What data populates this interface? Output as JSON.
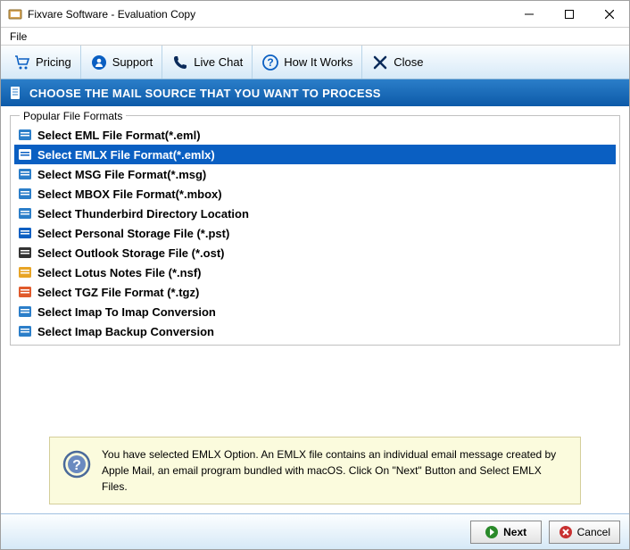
{
  "titlebar": {
    "title": "Fixvare Software - Evaluation Copy"
  },
  "menubar": {
    "file": "File"
  },
  "toolbar": {
    "pricing": "Pricing",
    "support": "Support",
    "livechat": "Live Chat",
    "howitworks": "How It Works",
    "close": "Close"
  },
  "header": {
    "text": "CHOOSE THE MAIL SOURCE THAT YOU WANT TO PROCESS"
  },
  "list": {
    "legend": "Popular File Formats",
    "items": [
      {
        "label": "Select EML File Format(*.eml)",
        "selected": false,
        "iconColor": "#2b7ec9"
      },
      {
        "label": "Select EMLX File Format(*.emlx)",
        "selected": true,
        "iconColor": "#ffffff"
      },
      {
        "label": "Select MSG File Format(*.msg)",
        "selected": false,
        "iconColor": "#2b7ec9"
      },
      {
        "label": "Select MBOX File Format(*.mbox)",
        "selected": false,
        "iconColor": "#2b7ec9"
      },
      {
        "label": "Select Thunderbird Directory Location",
        "selected": false,
        "iconColor": "#2b7ec9"
      },
      {
        "label": "Select Personal Storage File (*.pst)",
        "selected": false,
        "iconColor": "#0a5fc2"
      },
      {
        "label": "Select Outlook Storage File (*.ost)",
        "selected": false,
        "iconColor": "#333333"
      },
      {
        "label": "Select Lotus Notes File (*.nsf)",
        "selected": false,
        "iconColor": "#e8a425"
      },
      {
        "label": "Select TGZ File Format (*.tgz)",
        "selected": false,
        "iconColor": "#e05a2b"
      },
      {
        "label": "Select Imap To Imap Conversion",
        "selected": false,
        "iconColor": "#2b7ec9"
      },
      {
        "label": "Select Imap Backup Conversion",
        "selected": false,
        "iconColor": "#2b7ec9"
      }
    ]
  },
  "info": {
    "text": "You have selected EMLX Option. An EMLX file contains an individual email message created by Apple Mail, an email program bundled with macOS. Click On \"Next\" Button and Select EMLX Files."
  },
  "footer": {
    "next": "Next",
    "cancel": "Cancel"
  }
}
